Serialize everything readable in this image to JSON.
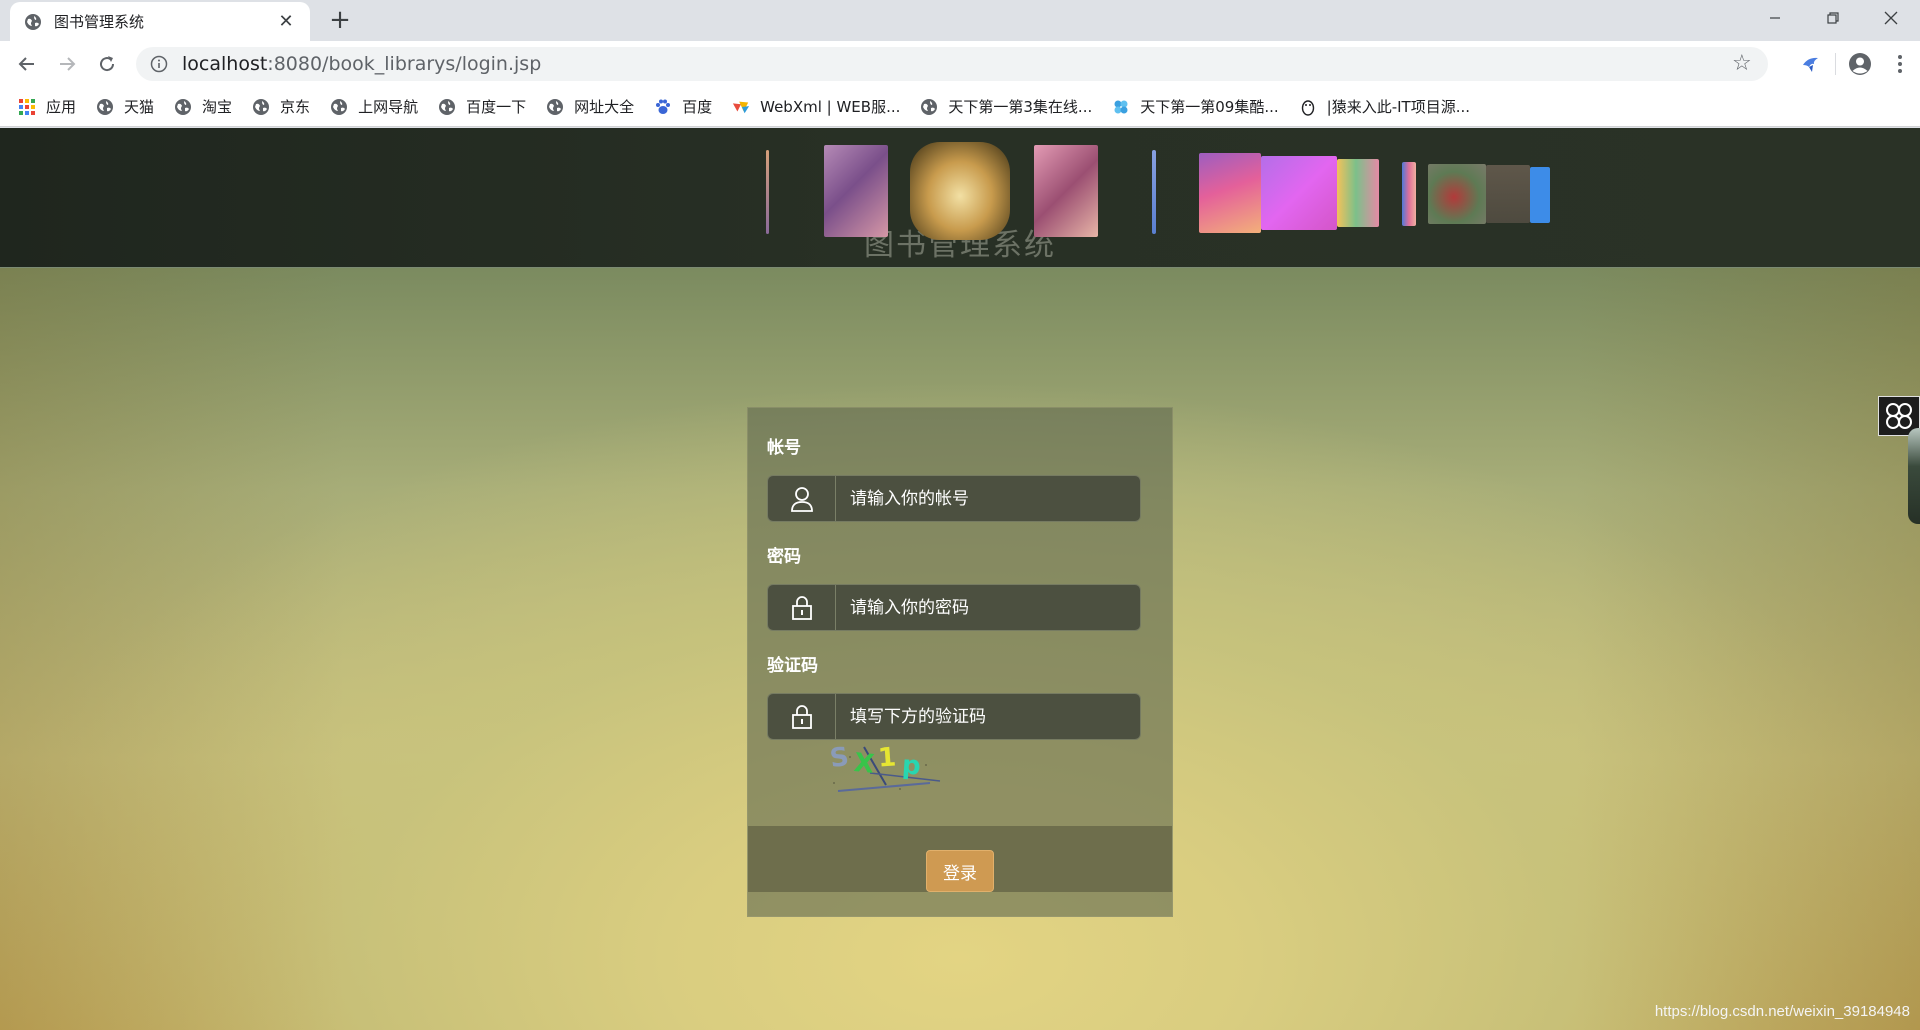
{
  "browser": {
    "tab_title": "图书管理系统",
    "url_host": "localhost",
    "url_rest": ":8080/book_librarys/login.jsp",
    "bookmarks": [
      {
        "label": "应用",
        "icon": "apps-grid-icon"
      },
      {
        "label": "天猫",
        "icon": "globe-icon"
      },
      {
        "label": "淘宝",
        "icon": "globe-icon"
      },
      {
        "label": "京东",
        "icon": "globe-icon"
      },
      {
        "label": "上网导航",
        "icon": "globe-icon"
      },
      {
        "label": "百度一下",
        "icon": "globe-icon"
      },
      {
        "label": "网址大全",
        "icon": "globe-icon"
      },
      {
        "label": "百度",
        "icon": "baidu-paw-icon"
      },
      {
        "label": "WebXml | WEB服...",
        "icon": "webxml-icon"
      },
      {
        "label": "天下第一第3集在线...",
        "icon": "globe-icon"
      },
      {
        "label": "天下第一第09集酷...",
        "icon": "flower-icon"
      },
      {
        "label": "|猿来入此-IT项目源...",
        "icon": "penguin-icon"
      }
    ]
  },
  "page": {
    "site_title": "图书管理系统",
    "account": {
      "label": "帐号",
      "placeholder": "请输入你的帐号"
    },
    "password": {
      "label": "密码",
      "placeholder": "请输入你的密码"
    },
    "captcha": {
      "label": "验证码",
      "placeholder": "填写下方的验证码",
      "code": [
        "S",
        "X",
        "1",
        "p"
      ],
      "colors": [
        "#8a9bb8",
        "#38c44a",
        "#e6e632",
        "#28d6b0"
      ]
    },
    "login_button": "登录",
    "watermark": "https://blog.csdn.net/weixin_39184948"
  }
}
